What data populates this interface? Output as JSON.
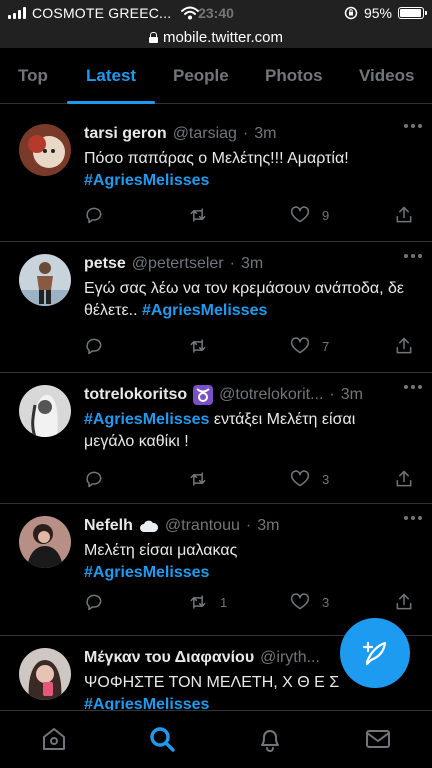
{
  "status_bar": {
    "carrier": "COSMOTE GREEC...",
    "time": "23:40",
    "battery": "95%",
    "battery_level": 0.95,
    "icons": [
      "signal-icon",
      "wifi-icon",
      "orientation-lock-icon",
      "battery-icon"
    ]
  },
  "url_bar": {
    "url": "mobile.twitter.com",
    "icon": "lock-icon"
  },
  "tabs": [
    {
      "label": "Top",
      "active": false
    },
    {
      "label": "Latest",
      "active": true
    },
    {
      "label": "People",
      "active": false
    },
    {
      "label": "Photos",
      "active": false
    },
    {
      "label": "Videos",
      "active": false
    }
  ],
  "tweets": [
    {
      "name": "tarsi geron",
      "handle": "@tarsiag",
      "dot": "·",
      "time": "3m",
      "text_lines": [
        {
          "plain": "Πόσο παπάρας ο Μελέτης!!! Αμαρτία!",
          "hashtag": ""
        },
        {
          "plain": "",
          "hashtag": "#AgriesMelisses"
        }
      ],
      "reply_count": "",
      "retweet_count": "",
      "like_count": "9"
    },
    {
      "name": "petse",
      "handle": "@petertseler",
      "dot": "·",
      "time": "3m",
      "text_lines": [
        {
          "plain": "Εγώ σας λέω να τον κρεμάσουν ανάποδα, δε",
          "hashtag": ""
        },
        {
          "plain": "θέλετε.. ",
          "hashtag": "#AgriesMelisses"
        }
      ],
      "reply_count": "",
      "retweet_count": "",
      "like_count": "7"
    },
    {
      "name": "totrelokoritso",
      "emoji": "taurus-symbol-icon",
      "handle": "@totrelokorit...",
      "dot": "·",
      "time": "3m",
      "text_lines": [
        {
          "plain": "",
          "hashtag": "#AgriesMelisses",
          "after": " εντάξει Μελέτη είσαι"
        },
        {
          "plain": "μεγάλο καθίκι !",
          "hashtag": ""
        }
      ],
      "reply_count": "",
      "retweet_count": "",
      "like_count": "3"
    },
    {
      "name": "Nefelh",
      "emoji": "cloud-icon",
      "handle": "@trantouu",
      "dot": "·",
      "time": "3m",
      "text_lines": [
        {
          "plain": "Μελέτη είσαι μαλακας",
          "hashtag": ""
        },
        {
          "plain": "",
          "hashtag": "#AgriesMelisses"
        }
      ],
      "reply_count": "",
      "retweet_count": "1",
      "like_count": "3"
    },
    {
      "name": "Μέγκαν του Διαφανίου",
      "handle": "@iryth...",
      "dot": "",
      "time": "",
      "text_lines": [
        {
          "plain": "ΨΟΦΗΣΤΕ ΤΟΝ ΜΕΛΕΤΗ, Χ Θ Ε Σ",
          "hashtag": ""
        },
        {
          "plain": "",
          "hashtag": "#AgriesMelisses"
        }
      ],
      "reply_count": "",
      "retweet_count": "",
      "like_count": ""
    }
  ],
  "bottom_nav": [
    {
      "icon": "home-icon",
      "active": false
    },
    {
      "icon": "search-icon",
      "active": true
    },
    {
      "icon": "notifications-bell-icon",
      "active": false
    },
    {
      "icon": "messages-envelope-icon",
      "active": false
    }
  ],
  "fab": {
    "icon": "compose-tweet-icon"
  },
  "colors": {
    "background": "#000000",
    "accent": "#1d9bf0",
    "muted": "#71767b",
    "divider": "#2f3336",
    "chrome": "#212121"
  }
}
